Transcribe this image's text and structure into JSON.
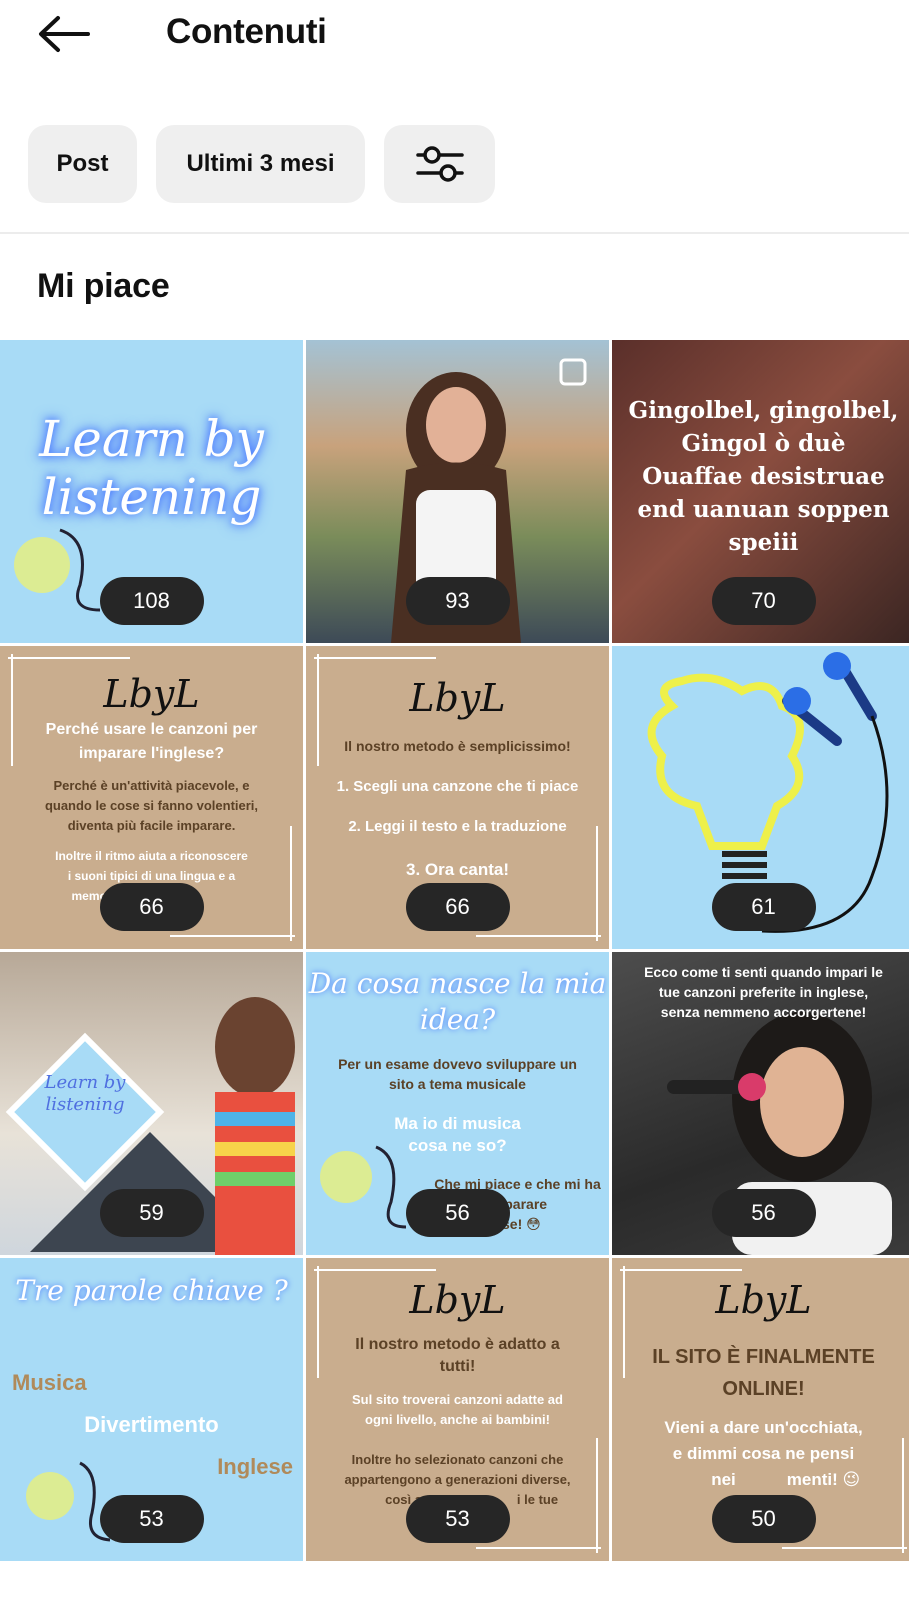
{
  "header": {
    "title": "Contenuti",
    "back_icon": "arrow-left-icon"
  },
  "filters": {
    "type_label": "Post",
    "period_label": "Ultimi 3 mesi",
    "settings_icon": "sliders-icon"
  },
  "section": {
    "title": "Mi piace"
  },
  "posts": [
    {
      "likes": "108",
      "lines": [
        "Learn by",
        "listening"
      ]
    },
    {
      "likes": "93"
    },
    {
      "likes": "70",
      "lines": [
        "Gingolbel, gingolbel,",
        "Gingol ò duè",
        "Ouaffae desistruae",
        "end uanuan soppen",
        "speiii"
      ]
    },
    {
      "likes": "66",
      "logo": "LbyL",
      "title": "Perché usare le canzoni per imparare l'inglese?",
      "lines": [
        "Perché è un'attività piacevole, e",
        "quando le cose si fanno volentieri,",
        "diventa più facile imparare.",
        "Inoltre il ritmo aiuta a riconoscere",
        "i suoni tipici di una lingua e a",
        "memor"
      ]
    },
    {
      "likes": "66",
      "logo": "LbyL",
      "lines": [
        "Il nostro metodo è semplicissimo!",
        "1. Scegli una canzone che ti piace",
        "2. Leggi il testo e la traduzione",
        "3. Ora canta!"
      ]
    },
    {
      "likes": "61"
    },
    {
      "likes": "59",
      "lines": [
        "Learn by",
        "listening"
      ]
    },
    {
      "likes": "56",
      "title": "Da cosa nasce la mia idea?",
      "lines": [
        "Per un esame dovevo sviluppare un",
        "sito a tema musicale",
        "Ma io di musica",
        "cosa ne so?",
        "Che mi piace e che mi ha",
        "imparare",
        "ese! 😳"
      ]
    },
    {
      "likes": "56",
      "lines": [
        "Ecco come ti senti quando impari le",
        "tue canzoni preferite in inglese,",
        "senza nemmeno accorgertene!"
      ]
    },
    {
      "likes": "53",
      "title": "Tre parole chiave ?",
      "lines": [
        "Musica",
        "Divertimento",
        "Inglese"
      ]
    },
    {
      "likes": "53",
      "logo": "LbyL",
      "lines": [
        "Il nostro metodo è adatto a",
        "tutti!",
        "Sul sito troverai canzoni adatte ad",
        "ogni livello, anche ai bambini!",
        "Inoltre ho selezionato canzoni che",
        "appartengono a generazioni diverse,",
        "così an",
        "i le tue"
      ]
    },
    {
      "likes": "50",
      "logo": "LbyL",
      "lines": [
        "IL SITO È FINALMENTE",
        "ONLINE!",
        "Vieni a dare un'occhiata,",
        "e dimmi cosa ne pensi",
        "nei ",
        "menti! 😉"
      ]
    }
  ],
  "colors": {
    "chip_bg": "#efefef",
    "badge_bg": "#262626",
    "tile_blue": "#a8dbf6",
    "tile_beige": "#c9ad8e"
  }
}
